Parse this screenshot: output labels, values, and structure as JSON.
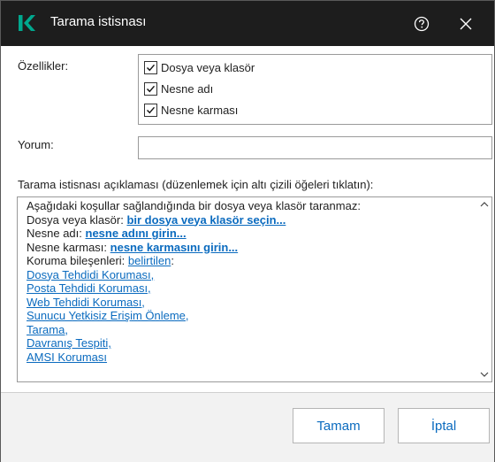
{
  "window": {
    "title": "Tarama istisnası",
    "logo_letter": "K",
    "help_icon": "help-circle-icon",
    "close_icon": "close-icon"
  },
  "properties": {
    "label": "Özellikler:",
    "options": [
      {
        "label": "Dosya veya klasör",
        "checked": true
      },
      {
        "label": "Nesne adı",
        "checked": true
      },
      {
        "label": "Nesne karması",
        "checked": true
      }
    ]
  },
  "comment": {
    "label": "Yorum:",
    "value": "",
    "placeholder": ""
  },
  "description": {
    "label": "Tarama istisnası açıklaması (düzenlemek için altı çizili öğeleri tıklatın):",
    "intro": "Aşağıdaki koşullar sağlandığında bir dosya veya klasör taranmaz:",
    "file_prefix": "Dosya veya klasör: ",
    "file_link": "bir dosya veya klasör seçin...",
    "name_prefix": "Nesne adı: ",
    "name_link": "nesne adını girin...",
    "hash_prefix": "Nesne karması: ",
    "hash_link": "nesne karmasını girin...",
    "components_prefix": "Koruma bileşenleri: ",
    "components_link": "belirtilen",
    "components_suffix": ":",
    "components": [
      "Dosya Tehdidi Koruması,",
      "Posta Tehdidi Koruması,",
      "Web Tehdidi Koruması,",
      "Sunucu Yetkisiz Erişim Önleme,",
      "Tarama,",
      "Davranış Tespiti,",
      "AMSI Koruması"
    ]
  },
  "buttons": {
    "ok": "Tamam",
    "cancel": "İptal"
  },
  "colors": {
    "titlebar": "#1d1d1d",
    "logo": "#00a88e",
    "link": "#0b6bbf"
  }
}
